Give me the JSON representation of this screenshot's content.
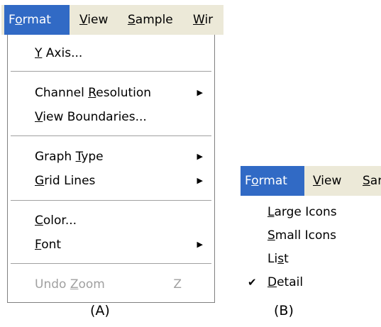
{
  "menu_a": {
    "menubar": [
      {
        "pre": "F",
        "key": "o",
        "post": "rmat"
      },
      {
        "pre": "",
        "key": "V",
        "post": "iew"
      },
      {
        "pre": "",
        "key": "S",
        "post": "ample"
      },
      {
        "pre": "",
        "key": "W",
        "post": "ir"
      }
    ],
    "items": [
      {
        "pre": "",
        "key": "Y",
        "post": " Axis..."
      },
      {
        "pre": "Channel ",
        "key": "R",
        "post": "esolution"
      },
      {
        "pre": "",
        "key": "V",
        "post": "iew Boundaries..."
      },
      {
        "pre": "Graph ",
        "key": "T",
        "post": "ype"
      },
      {
        "pre": "",
        "key": "G",
        "post": "rid Lines"
      },
      {
        "pre": "",
        "key": "C",
        "post": "olor..."
      },
      {
        "pre": "",
        "key": "F",
        "post": "ont"
      },
      {
        "pre": "Undo ",
        "key": "Z",
        "post": "oom",
        "shortcut": "Z"
      }
    ]
  },
  "menu_b": {
    "menubar": [
      {
        "pre": "F",
        "key": "o",
        "post": "rmat"
      },
      {
        "pre": "",
        "key": "V",
        "post": "iew"
      },
      {
        "pre": "",
        "key": "S",
        "post": "ar"
      }
    ],
    "items": [
      {
        "pre": "",
        "key": "L",
        "post": "arge Icons"
      },
      {
        "pre": "",
        "key": "S",
        "post": "mall Icons"
      },
      {
        "pre": "Li",
        "key": "s",
        "post": "t"
      },
      {
        "pre": "",
        "key": "D",
        "post": "etail"
      }
    ]
  },
  "captions": {
    "a": "(A)",
    "b": "(B)"
  },
  "colors": {
    "menubar_bg": "#ece9d8",
    "highlight": "#316ac5",
    "disabled": "#a0a0a0"
  },
  "icons": {
    "submenu_arrow": "submenu-arrow-icon",
    "check": "checkmark-icon"
  }
}
